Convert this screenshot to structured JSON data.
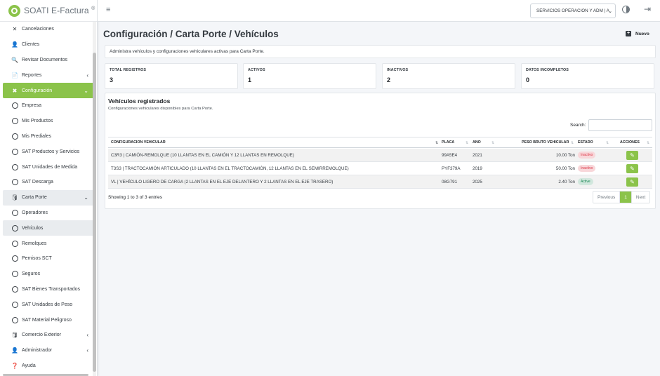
{
  "brand": {
    "name": "SOATI E-Factura",
    "reg": "®"
  },
  "sidebar": {
    "items": [
      {
        "label": "Cancelaciones",
        "icon": "close-icon",
        "glyph": "✕"
      },
      {
        "label": "Clientes",
        "icon": "user-icon",
        "glyph": "👤"
      },
      {
        "label": "Revisar Documentos",
        "icon": "search-doc-icon",
        "glyph": "🔍"
      },
      {
        "label": "Reportes",
        "icon": "report-icon",
        "glyph": "📄",
        "arrow": "‹"
      },
      {
        "label": "Configuración",
        "icon": "tools-icon",
        "glyph": "✖",
        "arrow": "⌄"
      },
      {
        "label": "Empresa",
        "icon": "circle-icon"
      },
      {
        "label": "Mis Productos",
        "icon": "circle-icon"
      },
      {
        "label": "Mis Prediales",
        "icon": "circle-icon"
      },
      {
        "label": "SAT Productos y Servicios",
        "icon": "circle-icon"
      },
      {
        "label": "SAT Unidades de Medida",
        "icon": "circle-icon"
      },
      {
        "label": "SAT Descarga",
        "icon": "circle-icon"
      },
      {
        "label": "Carta Porte",
        "icon": "database-icon",
        "glyph": "🛢",
        "arrow": "⌄"
      },
      {
        "label": "Operadores",
        "icon": "circle-icon"
      },
      {
        "label": "Vehículos",
        "icon": "circle-icon"
      },
      {
        "label": "Remolques",
        "icon": "circle-icon"
      },
      {
        "label": "Pemisos SCT",
        "icon": "circle-icon"
      },
      {
        "label": "Seguros",
        "icon": "circle-icon"
      },
      {
        "label": "SAT Bienes Transportados",
        "icon": "circle-icon"
      },
      {
        "label": "SAT Unidades de Peso",
        "icon": "circle-icon"
      },
      {
        "label": "SAT Material Peligroso",
        "icon": "circle-icon"
      },
      {
        "label": "Comercio Exterior",
        "icon": "database-icon",
        "glyph": "🛢",
        "arrow": "‹"
      },
      {
        "label": "Administrador",
        "icon": "user-gear-icon",
        "glyph": "👤",
        "arrow": "‹"
      },
      {
        "label": "Ayuda",
        "icon": "help-icon",
        "glyph": "❓"
      }
    ]
  },
  "topbar": {
    "menu_glyph": "≡",
    "company": "SERVICIOS OPERACION Y ADM | A",
    "company_chevron": "⌄",
    "logout_glyph": "⇥"
  },
  "page": {
    "title": "Configuración / Carta Porte / Vehículos",
    "new_button": "Nuevo",
    "new_glyph": "+",
    "description": "Administra vehículos y configuraciones vehiculares activas para Carta Porte."
  },
  "stats": [
    {
      "label": "TOTAL REGISTROS",
      "value": "3"
    },
    {
      "label": "ACTIVOS",
      "value": "1"
    },
    {
      "label": "INACTIVOS",
      "value": "2"
    },
    {
      "label": "DATOS INCOMPLETOS",
      "value": "0"
    }
  ],
  "table": {
    "title": "Vehículos registrados",
    "subtitle": "Configuraciones vehiculares disponibles para Carta Porte.",
    "search_label": "Search:",
    "search_value": "",
    "headers": {
      "config": "CONFIGURACION VEHICULAR",
      "placa": "PLACA",
      "anio": "ANO",
      "peso": "PESO BRUTO VEHICULAR",
      "estado": "ESTADO",
      "acciones": "ACCIONES"
    },
    "sort_glyph": "⇅",
    "rows": [
      {
        "config": "C3R3 | CAMIÓN-REMOLQUE (10 LLANTAS EN EL CAMIÓN Y 12 LLANTAS EN REMOLQUE)",
        "placa": "99A5E4",
        "anio": "2021",
        "peso": "10.00 Ton",
        "estado": "Inactivo",
        "status": "inactive"
      },
      {
        "config": "T3S3 | TRACTOCAMIÓN ARTICULADO (10 LLANTAS EN EL TRACTOCAMIÓN, 12 LLANTAS EN EL SEMIRREMOLQUE)",
        "placa": "PYF379A",
        "anio": "2019",
        "peso": "50.00 Ton",
        "estado": "Inactivo",
        "status": "inactive"
      },
      {
        "config": "VL | VEHÍCULO LIGERO DE CARGA (2 LLANTAS EN EL EJE DELANTERO Y 2 LLANTAS EN EL EJE TRASERO)",
        "placa": "08G791",
        "anio": "2025",
        "peso": "2.40 Ton",
        "estado": "Active",
        "status": "active"
      }
    ],
    "edit_glyph": "✎",
    "showing": "Showing 1 to 3 of 3 entries",
    "pager": {
      "previous": "Previous",
      "current": "1",
      "next": "Next"
    }
  },
  "colors": {
    "accent": "#8bc34a",
    "inactive": "#dc3545",
    "active": "#198754"
  }
}
